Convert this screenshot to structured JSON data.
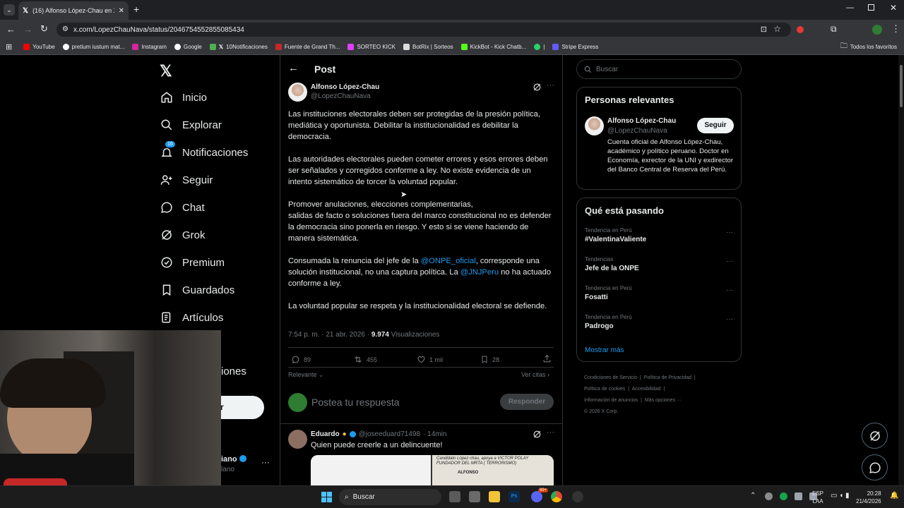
{
  "browser": {
    "tab_title": "(16) Alfonso López-Chau en X: ",
    "url": "x.com/LopezChauNava/status/2046754552855085434",
    "bookmarks": [
      "YouTube",
      "pretium iustum mat...",
      "Instagram",
      "Google",
      "10Notificaciones",
      "Fuente de Grand Th...",
      "SORTEO KICK",
      "BotRix | Sorteos",
      "KickBot - Kick Chatb...",
      "|",
      "Stripe Express"
    ],
    "all_bookmarks": "Todos los favoritos"
  },
  "nav": {
    "items": [
      "Inicio",
      "Explorar",
      "Notificaciones",
      "Seguir",
      "Chat",
      "Grok",
      "Premium",
      "Guardados",
      "Artículos"
    ],
    "notif_badge": "16",
    "partial_more": "iones",
    "partial_post_btn": "r",
    "partial_account_name": "iano",
    "partial_account_handle": "lano"
  },
  "post": {
    "header_title": "Post",
    "author_name": "Alfonso López-Chau",
    "author_handle": "@LopezChauNava",
    "p1": "Las instituciones electorales deben ser protegidas de la presión política, mediática y oportunista. Debilitar la institucionalidad es debilitar la democracia.",
    "p2": "Las autoridades electorales pueden cometer errores y esos errores deben ser señalados y corregidos conforme a ley. No existe evidencia de un intento sistemático de torcer la voluntad popular.",
    "p3a": "Promover anulaciones, elecciones complementarias,",
    "p3b": "salidas de facto o soluciones fuera del marco constitucional no es defender la democracia sino ponerla en riesgo. Y esto si se viene haciendo de manera sistemática.",
    "p4_pre": "Consumada la renuncia del jefe de la ",
    "p4_mention1": "@ONPE_oficial",
    "p4_mid": ", corresponde una solución institucional, no una captura política. La ",
    "p4_mention2": "@JNJPeru",
    "p4_post": " no ha actuado conforme a ley.",
    "p5": "La voluntad popular se respeta y la institucionalidad electoral se defiende.",
    "timestamp": "7:54 p. m. · 21 abr. 2026 · ",
    "views_count": "9.974",
    "views_label": " Visualizaciones",
    "replies": "89",
    "reposts": "455",
    "likes": "1 mil",
    "bookmarks": "28",
    "sort_label": "Relevante",
    "quotes_link": "Ver citas",
    "reply_placeholder": "Postea tu respuesta",
    "reply_button": "Responder"
  },
  "reply": {
    "name": "Eduardo",
    "handle": "@joseeduard71498",
    "time": " · 14min",
    "text": "Quien puede creerle a un delincuente!",
    "img_text": "Candidato López chau, apoya a VICTOR POLAY FUNDADOR DEL MRTA ( TERRORISMO)",
    "img_text2": "ALFONSO"
  },
  "sidebar": {
    "search_placeholder": "Buscar",
    "relevant_title": "Personas relevantes",
    "person_name": "Alfonso López-Chau",
    "person_handle": "@LopezChauNava",
    "follow_button": "Seguir",
    "person_bio": "Cuenta oficial de Alfonso López-Chau, académico y político peruano. Doctor en Economía, exrector de la UNI y exdirector del Banco Central de Reserva del Perú.",
    "trending_title": "Qué está pasando",
    "trends": [
      {
        "category": "Tendencia en Perú",
        "name": "#ValentinaValiente"
      },
      {
        "category": "Tendencias",
        "name": "Jefe de la ONPE"
      },
      {
        "category": "Tendencia en Perú",
        "name": "Fosatti"
      },
      {
        "category": "Tendencia en Perú",
        "name": "Padrogo"
      }
    ],
    "show_more": "Mostrar más",
    "footer1": "Condiciones de Servicio",
    "footer2": "Política de Privacidad",
    "footer3": "Política de cookies",
    "footer4": "Accesibilidad",
    "footer5": "Información de anuncios",
    "footer6": "Más opciones ···",
    "footer7": "© 2026 X Corp."
  },
  "taskbar": {
    "search": "Buscar",
    "lang1": "ESP",
    "lang2": "LAA",
    "time": "20:28",
    "date": "21/4/2026",
    "badge": "99+"
  },
  "colors": {
    "accent": "#1d9bf0",
    "bg": "#000000",
    "border": "#2f3336",
    "muted": "#71767b"
  }
}
